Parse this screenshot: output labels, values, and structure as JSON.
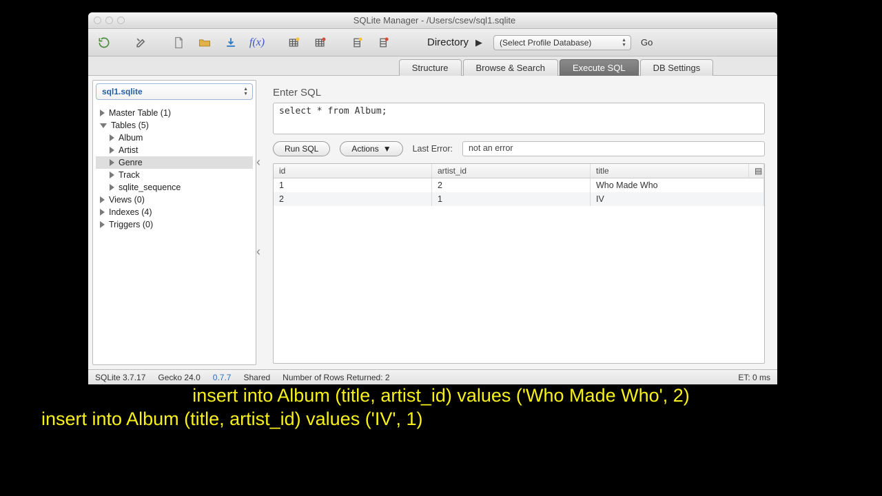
{
  "window": {
    "title": "SQLite Manager - /Users/csev/sql1.sqlite"
  },
  "toolbar": {
    "directory_label": "Directory",
    "profile_placeholder": "(Select Profile Database)",
    "go_label": "Go"
  },
  "tabs": {
    "structure": "Structure",
    "browse": "Browse & Search",
    "execute": "Execute SQL",
    "settings": "DB Settings"
  },
  "sidebar": {
    "db_name": "sql1.sqlite",
    "nodes": {
      "master": "Master Table (1)",
      "tables": "Tables (5)",
      "album": "Album",
      "artist": "Artist",
      "genre": "Genre",
      "track": "Track",
      "seq": "sqlite_sequence",
      "views": "Views (0)",
      "indexes": "Indexes (4)",
      "triggers": "Triggers (0)"
    }
  },
  "main": {
    "enter_label": "Enter SQL",
    "sql_text": "select * from Album;",
    "run_label": "Run SQL",
    "actions_label": "Actions",
    "lasterr_label": "Last Error:",
    "lasterr_value": "not an error"
  },
  "results": {
    "columns": {
      "id": "id",
      "artist_id": "artist_id",
      "title": "title"
    },
    "rows": [
      {
        "id": "1",
        "artist_id": "2",
        "title": "Who Made Who"
      },
      {
        "id": "2",
        "artist_id": "1",
        "title": "IV"
      }
    ]
  },
  "status": {
    "sqlite": "SQLite 3.7.17",
    "gecko": "Gecko 24.0",
    "version": "0.7.7",
    "mode": "Shared",
    "rows": "Number of Rows Returned: 2",
    "et": "ET: 0 ms"
  },
  "annotation": {
    "line1": "insert into Album (title, artist_id) values ('Who Made Who', 2)",
    "line2": "insert into Album (title, artist_id) values ('IV', 1)"
  }
}
